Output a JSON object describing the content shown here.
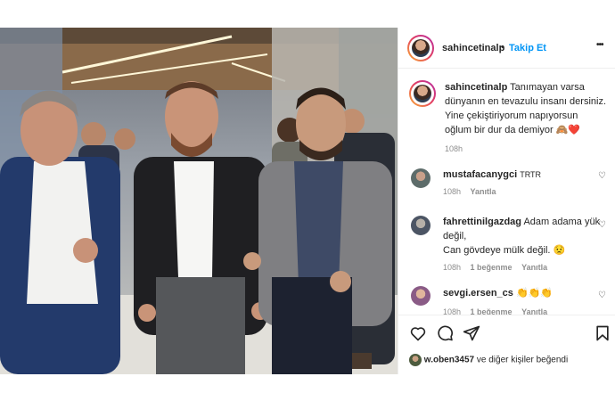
{
  "header": {
    "username": "sahincetinalp",
    "separator": "•",
    "follow_label": "Takip Et",
    "more_label": "•••"
  },
  "caption": {
    "username": "sahincetinalp",
    "text": "Tanımayan varsa dünyanın en tevazulu insanı dersiniz. Yine çekiştiriyorum napıyorsun oğlum bir dur da demiyor 🙈❤️",
    "time": "108h"
  },
  "comments": [
    {
      "username": "mustafacanygci",
      "text": "TRTR",
      "time": "108h",
      "likes": "",
      "reply_label": "Yanıtla"
    },
    {
      "username": "fahrettinilgazdag",
      "text": "Adam adama yük değil,",
      "text2": "Can gövdeye mülk değil. 😟",
      "time": "108h",
      "likes": "1 beğenme",
      "reply_label": "Yanıtla"
    },
    {
      "username": "sevgi.ersen_cs",
      "text": "👏👏👏",
      "time": "108h",
      "likes": "1 beğenme",
      "reply_label": "Yanıtla"
    }
  ],
  "likes_line": {
    "username": "w.oben3457",
    "rest": "ve diğer kişiler beğendi"
  },
  "colors": {
    "follow_blue": "#0095f6",
    "meta_gray": "#8e8e8e",
    "text": "#262626"
  },
  "icons": [
    "heart-icon",
    "comment-icon",
    "share-icon",
    "bookmark-icon",
    "more-icon"
  ]
}
